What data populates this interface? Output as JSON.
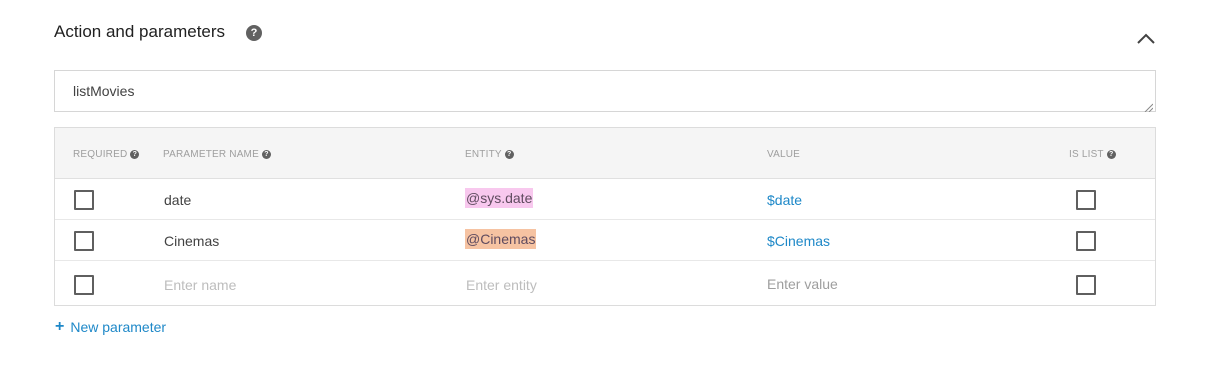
{
  "section": {
    "title": "Action and parameters",
    "help_icon": "?"
  },
  "action": {
    "value": "listMovies"
  },
  "table": {
    "headers": {
      "required": "REQUIRED",
      "parameter_name": "PARAMETER NAME",
      "entity": "ENTITY",
      "value": "VALUE",
      "is_list": "IS LIST"
    },
    "rows": [
      {
        "required": false,
        "name": "date",
        "entity": "@sys.date",
        "entity_color": "#f8c8ee",
        "value": "$date",
        "is_list": false
      },
      {
        "required": false,
        "name": "Cinemas",
        "entity": "@Cinemas",
        "entity_color": "#f6c3a2",
        "value": "$Cinemas",
        "is_list": false
      }
    ],
    "new_row": {
      "name_placeholder": "Enter name",
      "entity_placeholder": "Enter entity",
      "value_placeholder": "Enter value"
    }
  },
  "footer": {
    "new_parameter_label": "New parameter",
    "plus_icon": "+"
  },
  "colors": {
    "link": "#1e88c8"
  }
}
